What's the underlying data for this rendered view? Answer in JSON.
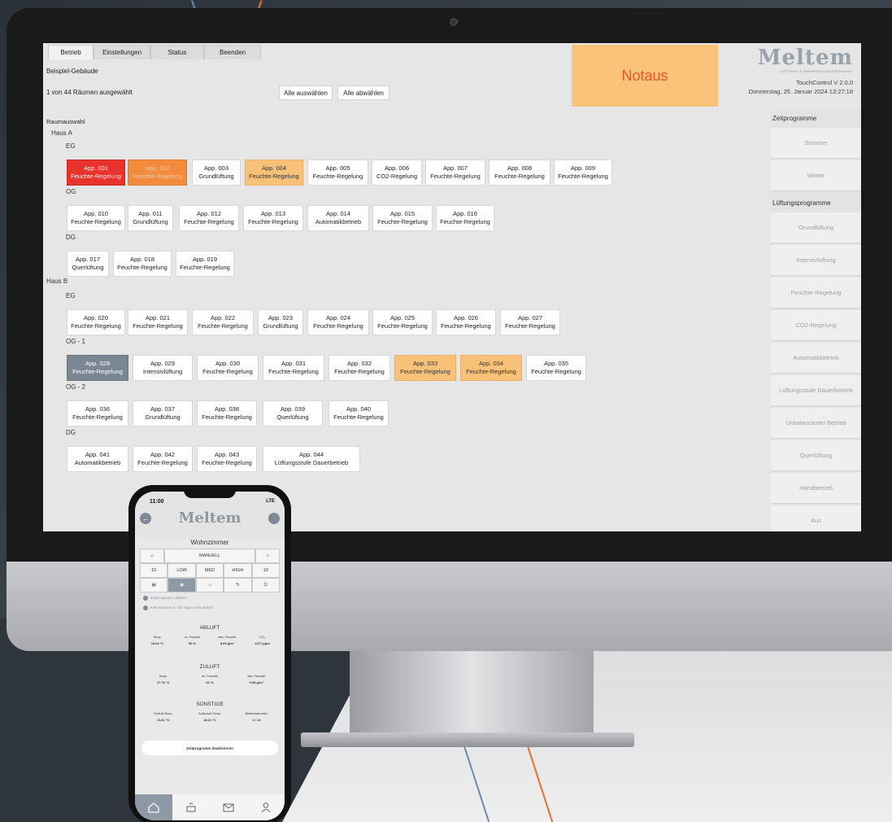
{
  "app": {
    "tabs": [
      "Betrieb",
      "Einstellungen",
      "Status",
      "Beenden"
    ],
    "building": "Beispiel-Gebäude",
    "selection_info": "1 von 44 Räumen ausgewählt",
    "select_all": "Alle auswählen",
    "deselect_all": "Alle abwählen",
    "notaus": "Notaus",
    "brand": "Meltem",
    "brand_tagline": "LÜFTUNG & WÄRMERÜCKGEWINNUNG",
    "version": "TouchControl V 2.0.0",
    "datetime": "Donnerstag, 25. Januar 2024 13:27:18",
    "room_selection_label": "Raumauswahl"
  },
  "houses": {
    "a": "Haus A",
    "b": "Haus B"
  },
  "floors": {
    "a_eg": "EG",
    "a_og": "OG",
    "a_dg": "DG",
    "b_eg": "EG",
    "b_og1": "OG - 1",
    "b_og2": "OG - 2",
    "b_dg": "DG"
  },
  "rooms": [
    {
      "name": "App. 001",
      "mode": "Feuchte-Regelung",
      "state": "red"
    },
    {
      "name": "App. 002",
      "mode": "Feuchte-Regelung",
      "state": "orange"
    },
    {
      "name": "App. 003",
      "mode": "Grundlüftung",
      "state": "normal"
    },
    {
      "name": "App. 004",
      "mode": "Feuchte-Regelung",
      "state": "yellow"
    },
    {
      "name": "App. 005",
      "mode": "Feuchte-Regelung",
      "state": "normal"
    },
    {
      "name": "App. 006",
      "mode": "CO2-Regelung",
      "state": "normal"
    },
    {
      "name": "App. 007",
      "mode": "Feuchte-Regelung",
      "state": "normal"
    },
    {
      "name": "App. 008",
      "mode": "Feuchte-Regelung",
      "state": "normal"
    },
    {
      "name": "App. 009",
      "mode": "Feuchte-Regelung",
      "state": "normal"
    },
    {
      "name": "App. 010",
      "mode": "Feuchte-Regelung",
      "state": "normal"
    },
    {
      "name": "App. 011",
      "mode": "Grundlüftung",
      "state": "normal"
    },
    {
      "name": "App. 012",
      "mode": "Feuchte-Regelung",
      "state": "normal"
    },
    {
      "name": "App. 013",
      "mode": "Feuchte-Regelung",
      "state": "normal"
    },
    {
      "name": "App. 014",
      "mode": "Automatikbetrieb",
      "state": "normal"
    },
    {
      "name": "App. 015",
      "mode": "Feuchte-Regelung",
      "state": "normal"
    },
    {
      "name": "App. 016",
      "mode": "Feuchte-Regelung",
      "state": "normal"
    },
    {
      "name": "App. 017",
      "mode": "Querlüftung",
      "state": "normal"
    },
    {
      "name": "App. 018",
      "mode": "Feuchte-Regelung",
      "state": "normal"
    },
    {
      "name": "App. 019",
      "mode": "Feuchte-Regelung",
      "state": "normal"
    },
    {
      "name": "App. 020",
      "mode": "Feuchte-Regelung",
      "state": "normal"
    },
    {
      "name": "App. 021",
      "mode": "Feuchte-Regelung",
      "state": "normal"
    },
    {
      "name": "App. 022",
      "mode": "Feuchte-Regelung",
      "state": "normal"
    },
    {
      "name": "App. 023",
      "mode": "Grundlüftung",
      "state": "normal"
    },
    {
      "name": "App. 024",
      "mode": "Feuchte-Regelung",
      "state": "normal"
    },
    {
      "name": "App. 025",
      "mode": "Feuchte-Regelung",
      "state": "normal"
    },
    {
      "name": "App. 026",
      "mode": "Feuchte-Regelung",
      "state": "normal"
    },
    {
      "name": "App. 027",
      "mode": "Feuchte-Regelung",
      "state": "normal"
    },
    {
      "name": "App. 028",
      "mode": "Feuchte-Regelung",
      "state": "gray"
    },
    {
      "name": "App. 029",
      "mode": "Intensivlüftung",
      "state": "normal"
    },
    {
      "name": "App. 030",
      "mode": "Feuchte-Regelung",
      "state": "normal"
    },
    {
      "name": "App. 031",
      "mode": "Feuchte-Regelung",
      "state": "normal"
    },
    {
      "name": "App. 032",
      "mode": "Feuchte-Regelung",
      "state": "normal"
    },
    {
      "name": "App. 033",
      "mode": "Feuchte-Regelung",
      "state": "yellow"
    },
    {
      "name": "App. 034",
      "mode": "Feuchte-Regelung",
      "state": "yellow"
    },
    {
      "name": "App. 035",
      "mode": "Feuchte-Regelung",
      "state": "normal"
    },
    {
      "name": "App. 036",
      "mode": "Feuchte-Regelung",
      "state": "normal"
    },
    {
      "name": "App. 037",
      "mode": "Grundlüftung",
      "state": "normal"
    },
    {
      "name": "App. 038",
      "mode": "Feuchte-Regelung",
      "state": "normal"
    },
    {
      "name": "App. 039",
      "mode": "Querlüftung",
      "state": "normal"
    },
    {
      "name": "App. 040",
      "mode": "Feuchte-Regelung",
      "state": "normal"
    },
    {
      "name": "App. 041",
      "mode": "Automatikbetrieb",
      "state": "normal"
    },
    {
      "name": "App. 042",
      "mode": "Feuchte-Regelung",
      "state": "normal"
    },
    {
      "name": "App. 043",
      "mode": "Feuchte-Regelung",
      "state": "normal"
    },
    {
      "name": "App. 044",
      "mode": "Lüftungsstufe Dauerbetrieb",
      "state": "normal"
    }
  ],
  "sidebar": {
    "time_programs_label": "Zeitprogramme",
    "time_programs": [
      "Sommer",
      "Winter"
    ],
    "vent_programs_label": "Lüftungsprogramme",
    "vent_programs": [
      "Grundlüftung",
      "Intensivlüftung",
      "Feuchte-Regelung",
      "CO2-Regelung",
      "Automatikbetrieb",
      "Lüftungsstufe Dauerbetrieb",
      "Unbalancierter Betrieb",
      "Querlüftung",
      "Handbetrieb",
      "Aus"
    ]
  },
  "phone": {
    "time": "11:00",
    "status": "LTE",
    "brand": "Meltem",
    "room": "Wohnzimmer",
    "mode": "MANUELL",
    "levels": [
      "10",
      "LOW",
      "MED",
      "HIGH",
      "10"
    ],
    "info1": "Zeitprogramm aktiviert",
    "info2": "Filterwechsel in 100 Tagen erforderlich",
    "abluft_title": "ABLUFT",
    "abluft": [
      {
        "label": "Temp.",
        "value": "19.54 °C"
      },
      {
        "label": "rel. Feuchte",
        "value": "50 %"
      },
      {
        "label": "abs. Feuchte",
        "value": "8.65 g/m³"
      },
      {
        "label": "CO₂",
        "value": "1077 ppm"
      }
    ],
    "zuluft_title": "ZULUFT",
    "zuluft": [
      {
        "label": "Temp.",
        "value": "17.76 °C"
      },
      {
        "label": "rel. Feuchte",
        "value": "62 %"
      },
      {
        "label": "abs. Feuchte",
        "value": "9.38 g/m³"
      }
    ],
    "sonstige_title": "SONSTIGE",
    "sonstige": [
      {
        "label": "Fortluft-Temp.",
        "value": "11.81 °C"
      },
      {
        "label": "Außenluft-Temp.",
        "value": "18.21 °C"
      },
      {
        "label": "Betriebsstunden",
        "value": "1 / 13"
      }
    ],
    "deactivate": "Zeitprogramm deaktivieren"
  }
}
